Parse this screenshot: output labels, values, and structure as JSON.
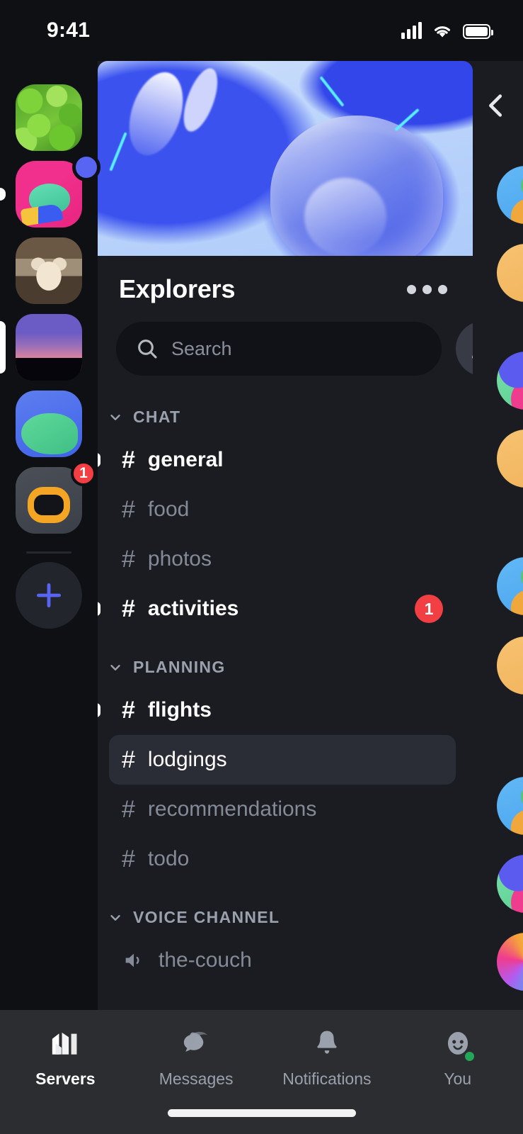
{
  "status_bar": {
    "time": "9:41",
    "signal_icon": "cellular-signal-icon",
    "wifi_icon": "wifi-icon",
    "battery_icon": "battery-icon"
  },
  "server_rail": {
    "servers": [
      {
        "name": "leaves-server",
        "art": "art-leaves",
        "state": "idle",
        "badge": null,
        "status_dot": false
      },
      {
        "name": "frog-server",
        "art": "art-frog",
        "state": "unread",
        "badge": null,
        "status_dot": true
      },
      {
        "name": "cat-server",
        "art": "art-cat",
        "state": "idle",
        "badge": null,
        "status_dot": false
      },
      {
        "name": "sunset-server",
        "art": "art-sunset",
        "state": "selected",
        "badge": null,
        "status_dot": false
      },
      {
        "name": "blob-server",
        "art": "art-blob",
        "state": "idle",
        "badge": null,
        "status_dot": false
      },
      {
        "name": "robot-server",
        "art": "art-robot",
        "state": "idle",
        "badge": "1",
        "status_dot": false
      }
    ],
    "add_server_label": "add-server-icon",
    "accent_color": "#5865f2"
  },
  "server": {
    "name": "Explorers",
    "banner_alt": "blue-glossy-3d-banner",
    "more_options_label": "more-options-icon",
    "add_member_label": "add-member-icon"
  },
  "search": {
    "placeholder": "Search",
    "value": "",
    "icon": "search-icon"
  },
  "channel_groups": [
    {
      "name": "CHAT",
      "collapse_icon": "chevron-down-icon",
      "channels": [
        {
          "name": "general",
          "type": "text",
          "state": "unread",
          "badge": null
        },
        {
          "name": "food",
          "type": "text",
          "state": "read",
          "badge": null
        },
        {
          "name": "photos",
          "type": "text",
          "state": "read",
          "badge": null
        },
        {
          "name": "activities",
          "type": "text",
          "state": "unread",
          "badge": "1"
        }
      ]
    },
    {
      "name": "PLANNING",
      "collapse_icon": "chevron-down-icon",
      "channels": [
        {
          "name": "flights",
          "type": "text",
          "state": "unread",
          "badge": null
        },
        {
          "name": "lodgings",
          "type": "text",
          "state": "selected",
          "badge": null
        },
        {
          "name": "recommendations",
          "type": "text",
          "state": "read",
          "badge": null
        },
        {
          "name": "todo",
          "type": "text",
          "state": "read",
          "badge": null
        }
      ]
    },
    {
      "name": "VOICE CHANNEL",
      "collapse_icon": "chevron-down-icon",
      "channels": [
        {
          "name": "the-couch",
          "type": "voice",
          "state": "read",
          "badge": null
        }
      ]
    }
  ],
  "member_panel": {
    "back_icon": "chevron-left-icon",
    "avatars": [
      "av-blue",
      "av-orange",
      "av-multi",
      "av-orange",
      "av-blue",
      "av-orange",
      "av-blue",
      "av-multi",
      "av-rainbow"
    ]
  },
  "bottom_nav": {
    "items": [
      {
        "label": "Servers",
        "icon": "servers-icon",
        "active": true
      },
      {
        "label": "Messages",
        "icon": "messages-icon",
        "active": false
      },
      {
        "label": "Notifications",
        "icon": "notifications-icon",
        "active": false
      },
      {
        "label": "You",
        "icon": "profile-avatar-icon",
        "active": false
      }
    ],
    "online_status_color": "#23a55a"
  },
  "colors": {
    "badge_red": "#f23f43",
    "accent_blurple": "#5865f2",
    "panel_bg": "#1a1c22",
    "nav_bg": "#2b2d31"
  }
}
